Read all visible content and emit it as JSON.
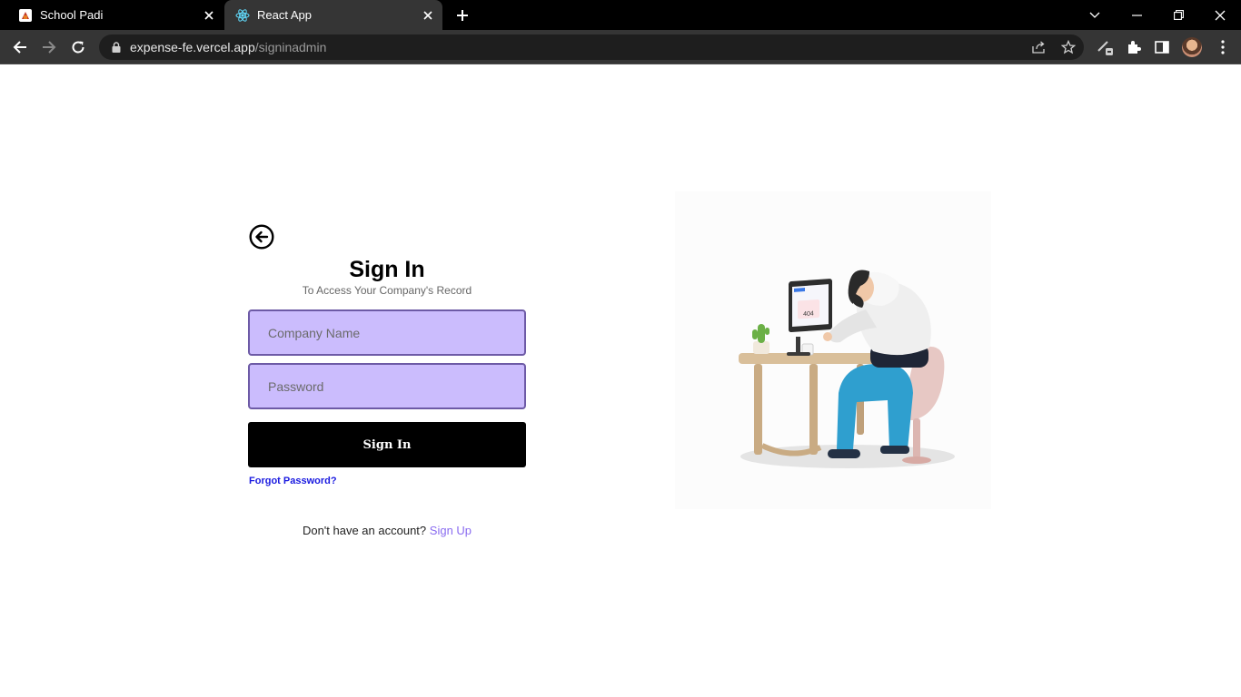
{
  "browser": {
    "tabs": [
      {
        "title": "School Padi",
        "active": false,
        "icon": "school-padi-favicon"
      },
      {
        "title": "React App",
        "active": true,
        "icon": "react-favicon"
      }
    ],
    "url_host": "expense-fe.vercel.app",
    "url_path": "/signinadmin"
  },
  "page": {
    "heading": "Sign In",
    "subheading": "To Access Your Company's Record",
    "company_placeholder": "Company Name",
    "password_placeholder": "Password",
    "signin_label": "Sign In",
    "forgot_label": "Forgot Password?",
    "signup_prompt": "Don't have an account?",
    "signup_link": "Sign Up",
    "illustration_text": "404"
  },
  "colors": {
    "input_fill": "#cbbcfd",
    "input_border": "#6d5aa6",
    "button": "#000000",
    "forgot_link": "#1a1ae0",
    "signup_link": "#8a6cf0"
  }
}
